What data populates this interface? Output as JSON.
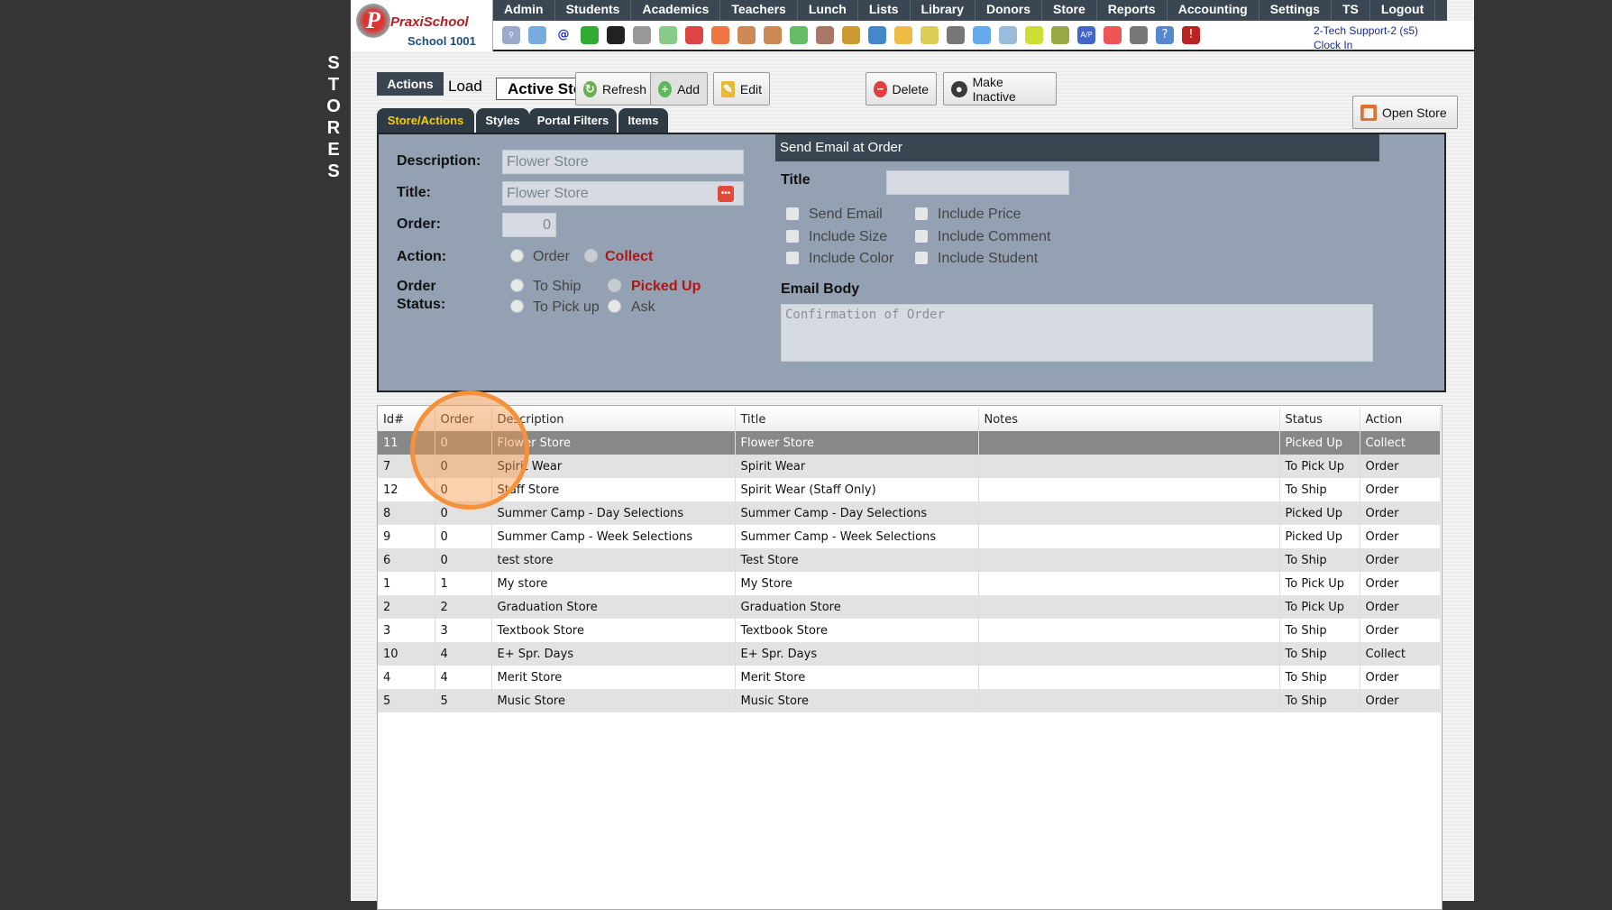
{
  "side_label": [
    "S",
    "T",
    "O",
    "R",
    "E",
    "S"
  ],
  "logo": {
    "brand": "PraxiSchool",
    "school": "School 1001"
  },
  "nav": [
    "Admin",
    "Students",
    "Academics",
    "Teachers",
    "Lunch",
    "Lists",
    "Library",
    "Donors",
    "Store",
    "Reports",
    "Accounting",
    "Settings",
    "TS",
    "Logout"
  ],
  "user": {
    "name": "2-Tech Support-2 (s5)",
    "clock_in": "Clock In"
  },
  "toolbar": {
    "actions": "Actions",
    "load": "Load",
    "load_value": "Active Stores",
    "refresh": "Refresh",
    "add": "Add",
    "edit": "Edit",
    "delete": "Delete",
    "make_inactive": "Make Inactive",
    "open_store": "Open Store"
  },
  "tabs": [
    "Store/Actions",
    "Styles",
    "Portal Filters",
    "Items"
  ],
  "form": {
    "description_label": "Description:",
    "description": "Flower Store",
    "title_label": "Title:",
    "title": "Flower Store",
    "order_label": "Order:",
    "order": "0",
    "action_label": "Action:",
    "action_options": [
      "Order",
      "Collect"
    ],
    "action_selected": "Collect",
    "status_label_1": "Order",
    "status_label_2": "Status:",
    "status_options": [
      "To Ship",
      "Picked Up",
      "To Pick up",
      "Ask"
    ],
    "status_selected": "Picked Up"
  },
  "email": {
    "header": "Send Email at Order",
    "title_label": "Title",
    "title": "",
    "checkboxes": [
      "Send Email",
      "Include Price",
      "Include Size",
      "Include Comment",
      "Include Color",
      "Include Student"
    ],
    "body_label": "Email Body",
    "body_placeholder": "Confirmation of Order"
  },
  "table": {
    "columns": [
      "Id#",
      "Order",
      "Description",
      "Title",
      "Notes",
      "Status",
      "Action"
    ],
    "rows": [
      [
        "11",
        "0",
        "Flower Store",
        "Flower Store",
        "",
        "Picked Up",
        "Collect"
      ],
      [
        "7",
        "0",
        "Spirit Wear",
        "Spirit Wear",
        "",
        "To Pick Up",
        "Order"
      ],
      [
        "12",
        "0",
        "Staff Store",
        "Spirit Wear (Staff Only)",
        "",
        "To Ship",
        "Order"
      ],
      [
        "8",
        "0",
        "Summer Camp - Day Selections",
        "Summer Camp - Day Selections",
        "",
        "Picked Up",
        "Order"
      ],
      [
        "9",
        "0",
        "Summer Camp - Week Selections",
        "Summer Camp - Week Selections",
        "",
        "Picked Up",
        "Order"
      ],
      [
        "6",
        "0",
        "test store",
        "Test Store",
        "",
        "To Ship",
        "Order"
      ],
      [
        "1",
        "1",
        "My store",
        "My Store",
        "",
        "To Pick Up",
        "Order"
      ],
      [
        "2",
        "2",
        "Graduation Store",
        "Graduation Store",
        "",
        "To Pick Up",
        "Order"
      ],
      [
        "3",
        "3",
        "Textbook Store",
        "Textbook Store",
        "",
        "To Ship",
        "Order"
      ],
      [
        "10",
        "4",
        "E+ Spr. Days",
        "E+ Spr. Days",
        "",
        "To Ship",
        "Collect"
      ],
      [
        "4",
        "4",
        "Merit Store",
        "Merit Store",
        "",
        "To Ship",
        "Order"
      ],
      [
        "5",
        "5",
        "Music Store",
        "Music Store",
        "",
        "To Ship",
        "Order"
      ]
    ],
    "selected_row": 0
  },
  "colors": {
    "nav": "#3a4753",
    "panel": "#93a1b3",
    "highlight": "#f5913a",
    "red": "#b01515"
  }
}
